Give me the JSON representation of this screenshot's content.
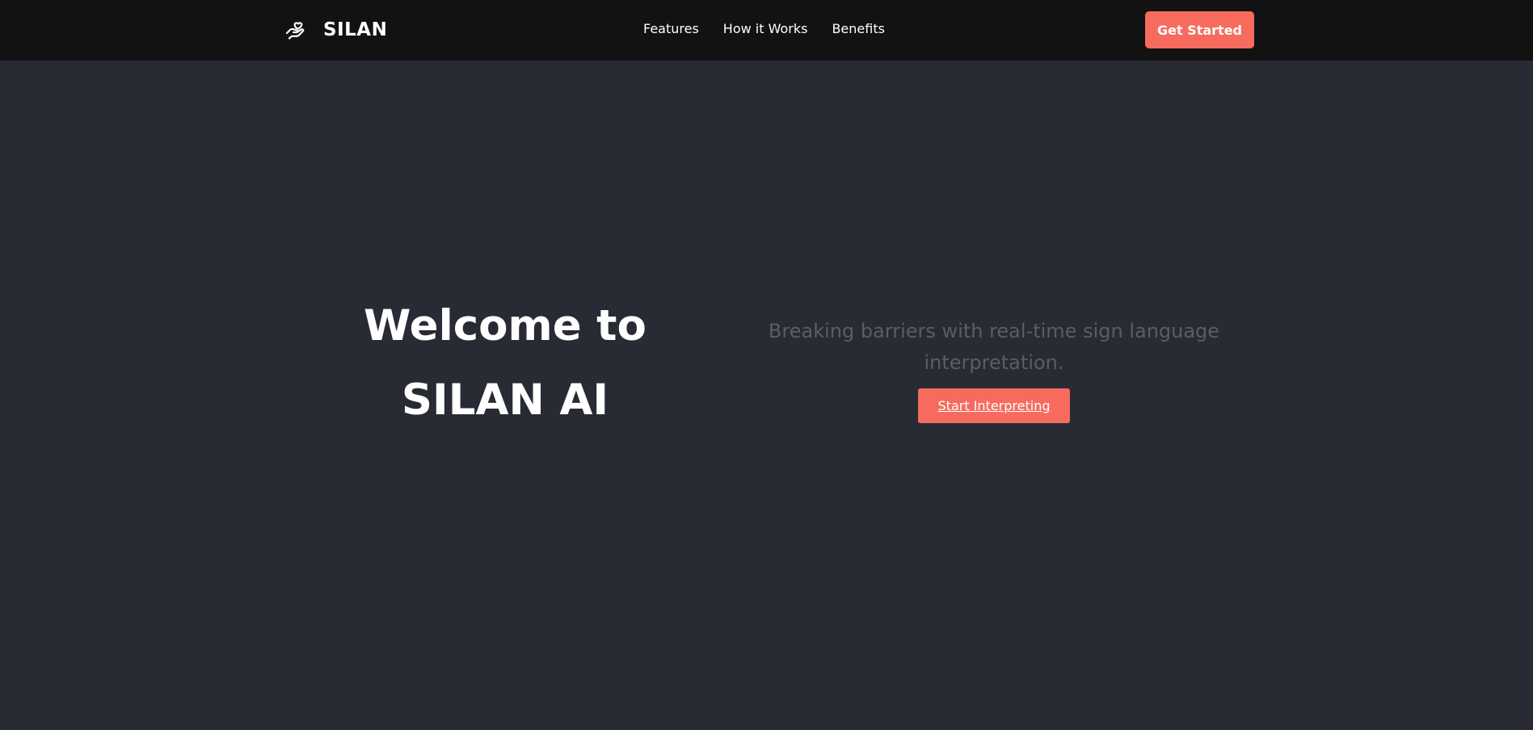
{
  "nav": {
    "brand_name": "SILAN",
    "brand_icon": "hand-heart-icon",
    "links": [
      "Features",
      "How it Works",
      "Benefits"
    ],
    "cta_label": "Get Started"
  },
  "hero": {
    "title": "Welcome to SILAN AI",
    "subtitle": "Breaking barriers with real-time sign language interpretation.",
    "button_label": "Start Interpreting"
  },
  "colors": {
    "accent": "#f76b5e",
    "navbar_bg": "#121212",
    "page_bg": "#282b34",
    "subtitle_text": "#5a5d66"
  }
}
